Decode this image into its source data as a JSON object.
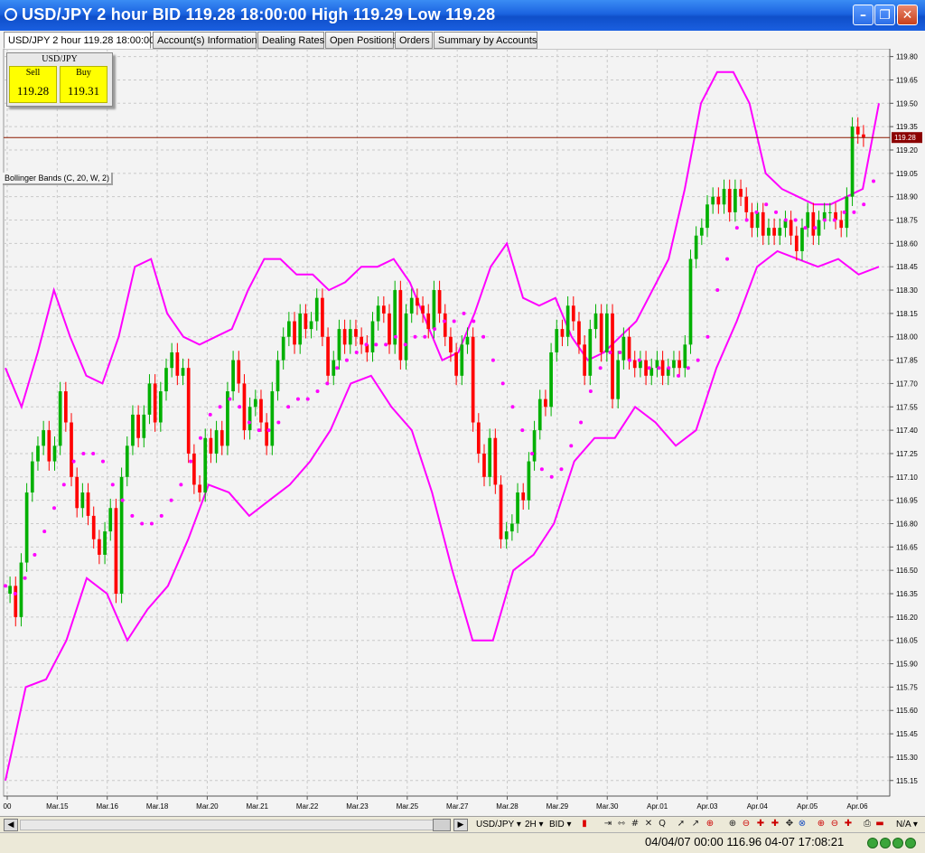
{
  "window": {
    "title": "USD/JPY 2 hour BID 119.28 18:00:00 High 119.29 Low 119.28",
    "minimize_label": "–",
    "maximize_label": "❐",
    "close_label": "✕"
  },
  "tabs": [
    {
      "label": "USD/JPY 2 hour 119.28 18:00:00",
      "active": true
    },
    {
      "label": "Account(s) Information",
      "active": false
    },
    {
      "label": "Dealing Rates",
      "active": false
    },
    {
      "label": "Open Positions",
      "active": false
    },
    {
      "label": "Orders",
      "active": false
    },
    {
      "label": "Summary by Accounts",
      "active": false
    }
  ],
  "quote": {
    "pair": "USD/JPY",
    "sell_label": "Sell",
    "sell_value": "119.28",
    "buy_label": "Buy",
    "buy_value": "119.31"
  },
  "indicator_label": "Bollinger Bands (C, 20, W, 2)",
  "colors": {
    "bull": "#00b000",
    "bear": "#ff0000",
    "band": "#ff00ff",
    "current_line": "#8b1a00",
    "price_tag_bg": "#8b0000",
    "background": "#f3f3f3",
    "grid": "#c9c9c9",
    "title_bar": "#1b63e0",
    "quote_bg": "#ffff00"
  },
  "chart_data": {
    "type": "candlestick",
    "symbol": "USD/JPY",
    "timeframe": "2 hour",
    "current_price": 119.28,
    "current_price_label": "119.28",
    "y_axis": {
      "ylim": [
        115.05,
        119.85
      ],
      "ticks": [
        "119.80",
        "119.65",
        "119.50",
        "119.35",
        "119.20",
        "119.05",
        "118.90",
        "118.75",
        "118.60",
        "118.45",
        "118.30",
        "118.15",
        "118.00",
        "117.85",
        "117.70",
        "117.55",
        "117.40",
        "117.25",
        "117.10",
        "116.95",
        "116.80",
        "116.65",
        "116.50",
        "116.35",
        "116.20",
        "116.05",
        "115.90",
        "115.75",
        "115.60",
        "115.45",
        "115.30",
        "115.15"
      ]
    },
    "x_axis": {
      "ticks": [
        "00",
        "Mar.15",
        "Mar.16",
        "Mar.18",
        "Mar.20",
        "Mar.21",
        "Mar.22",
        "Mar.23",
        "Mar.25",
        "Mar.27",
        "Mar.28",
        "Mar.29",
        "Mar.30",
        "Apr.01",
        "Apr.03",
        "Apr.04",
        "Apr.05",
        "Apr.06"
      ]
    },
    "grid": true,
    "closes": [
      116.4,
      116.2,
      116.55,
      117.0,
      117.2,
      117.3,
      117.4,
      117.2,
      117.3,
      117.65,
      117.45,
      117.1,
      116.9,
      117.0,
      116.85,
      116.7,
      116.6,
      116.75,
      116.9,
      116.35,
      117.1,
      117.3,
      117.5,
      117.35,
      117.5,
      117.7,
      117.45,
      117.65,
      117.8,
      117.9,
      117.75,
      117.8,
      117.25,
      117.05,
      117.0,
      117.35,
      117.25,
      117.4,
      117.3,
      117.65,
      117.85,
      117.7,
      117.4,
      117.55,
      117.6,
      117.45,
      117.3,
      117.65,
      117.85,
      118.0,
      118.1,
      117.95,
      118.15,
      118.05,
      118.1,
      118.25,
      118.0,
      117.75,
      117.85,
      118.05,
      117.95,
      118.05,
      118.0,
      117.95,
      117.9,
      118.1,
      118.2,
      118.15,
      117.95,
      118.3,
      117.85,
      118.15,
      118.25,
      118.2,
      118.15,
      118.05,
      118.3,
      118.15,
      118.0,
      117.9,
      117.75,
      117.95,
      118.0,
      117.45,
      117.25,
      117.1,
      117.35,
      117.05,
      116.7,
      116.75,
      116.8,
      117.0,
      116.95,
      117.2,
      117.4,
      117.6,
      117.55,
      117.9,
      118.05,
      118.0,
      118.2,
      118.1,
      117.95,
      117.75,
      118.05,
      118.15,
      117.9,
      118.15,
      117.6,
      117.85,
      118.0,
      117.85,
      117.8,
      117.85,
      117.75,
      117.8,
      117.85,
      117.75,
      117.8,
      117.85,
      117.8,
      117.95,
      118.5,
      118.65,
      118.7,
      118.85,
      118.9,
      118.85,
      118.95,
      118.8,
      118.95,
      118.9,
      118.8,
      118.7,
      118.8,
      118.65,
      118.7,
      118.65,
      118.7,
      118.75,
      118.65,
      118.55,
      118.7,
      118.8,
      118.65,
      118.75,
      118.8,
      118.8,
      118.75,
      118.7,
      118.9,
      119.35,
      119.3,
      119.28
    ],
    "series": [
      {
        "name": "Bollinger Middle",
        "values": [
          116.4,
          116.35,
          116.45,
          116.6,
          116.75,
          116.9,
          117.05,
          117.2,
          117.25,
          117.25,
          117.2,
          117.05,
          116.95,
          116.85,
          116.8,
          116.8,
          116.85,
          116.95,
          117.05,
          117.2,
          117.35,
          117.5,
          117.55,
          117.6,
          117.55,
          117.45,
          117.4,
          117.4,
          117.45,
          117.55,
          117.6,
          117.6,
          117.65,
          117.7,
          117.8,
          117.85,
          117.9,
          117.95,
          117.95,
          117.95,
          118.0,
          117.95,
          118.0,
          118.0,
          118.05,
          118.1,
          118.1,
          118.15,
          118.1,
          118.0,
          117.85,
          117.7,
          117.55,
          117.4,
          117.25,
          117.15,
          117.1,
          117.15,
          117.3,
          117.45,
          117.65,
          117.8,
          117.9,
          117.9,
          117.85,
          117.85,
          117.8,
          117.8,
          117.8,
          117.75,
          117.8,
          117.85,
          118.0,
          118.3,
          118.5,
          118.7,
          118.75,
          118.8,
          118.85,
          118.8,
          118.75,
          118.75,
          118.7,
          118.7,
          118.75,
          118.75,
          118.8,
          118.8,
          118.85,
          119.0
        ]
      },
      {
        "name": "Bollinger Upper",
        "values": [
          117.8,
          117.55,
          117.9,
          118.3,
          118.0,
          117.75,
          117.7,
          118.0,
          118.45,
          118.5,
          118.15,
          118.0,
          117.95,
          118.0,
          118.05,
          118.3,
          118.5,
          118.5,
          118.4,
          118.4,
          118.3,
          118.35,
          118.45,
          118.45,
          118.5,
          118.35,
          118.1,
          117.85,
          117.9,
          118.15,
          118.45,
          118.6,
          118.25,
          118.2,
          118.25,
          118.0,
          117.85,
          117.9,
          118.0,
          118.1,
          118.3,
          118.5,
          118.95,
          119.5,
          119.7,
          119.7,
          119.5,
          119.05,
          118.95,
          118.9,
          118.85,
          118.85,
          118.9,
          118.95,
          119.5
        ]
      },
      {
        "name": "Bollinger Lower",
        "values": [
          115.15,
          115.75,
          115.8,
          116.05,
          116.45,
          116.35,
          116.05,
          116.25,
          116.4,
          116.7,
          117.05,
          117.0,
          116.85,
          116.95,
          117.05,
          117.2,
          117.4,
          117.7,
          117.75,
          117.55,
          117.4,
          117.0,
          116.5,
          116.05,
          116.05,
          116.5,
          116.6,
          116.8,
          117.2,
          117.35,
          117.35,
          117.55,
          117.45,
          117.3,
          117.4,
          117.8,
          118.1,
          118.45,
          118.55,
          118.5,
          118.45,
          118.5,
          118.4,
          118.45
        ]
      }
    ]
  },
  "toolbar": {
    "symbol_select": "USD/JPY ▾",
    "period_select": "2H ▾",
    "price_select": "BID ▾",
    "zoom_select": "N/A ▾",
    "scroll_left_label": "◀",
    "scroll_right_label": "▶",
    "icons": [
      "cursor-icon",
      "draw-line-icon",
      "period-separator-icon",
      "grid-icon",
      "crosshair-icon",
      "zoom-icon",
      "arrow-icon",
      "retracement-icon",
      "fibonacci-icon",
      "zoom-in-icon",
      "zoom-out-icon",
      "cross-icon",
      "pan-icon",
      "tools-icon",
      "channel-icon",
      "clear-icon",
      "delete-icon",
      "settings-icon",
      "print-icon",
      "layout-icon"
    ]
  },
  "status": {
    "text": "04/04/07 00:00   116.96  04-07 17:08:21"
  }
}
